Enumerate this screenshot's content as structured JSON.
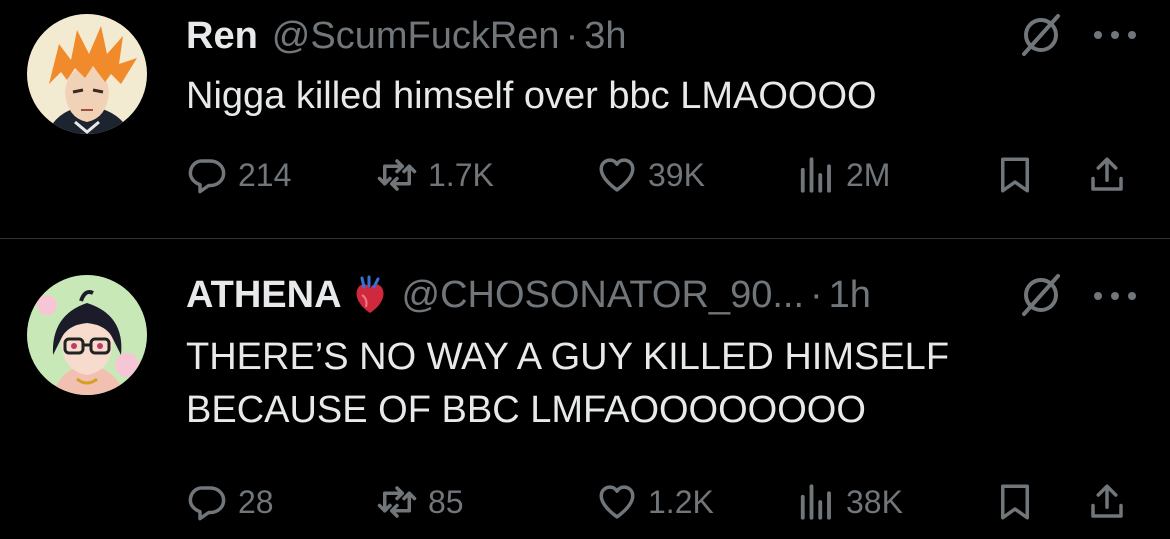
{
  "tweets": [
    {
      "name": "Ren",
      "handle": "@ScumFuckRen",
      "separator": "·",
      "time": "3h",
      "text": "Nigga killed himself over bbc LMAOOOO",
      "replies": "214",
      "retweets": "1.7K",
      "likes": "39K",
      "views": "2M",
      "avatar_icon": "anime-orange-hair-avatar",
      "name_emoji": ""
    },
    {
      "name": "ATHENA",
      "handle": "@CHOSONATOR_90...",
      "separator": "·",
      "time": "1h",
      "text_lines": [
        "THERE’S NO WAY A GUY KILLED HIMSELF",
        "BECAUSE OF BBC LMFAOOOOOOOO"
      ],
      "replies": "28",
      "retweets": "85",
      "likes": "1.2K",
      "views": "38K",
      "avatar_icon": "anime-glasses-girl-avatar",
      "name_emoji": "anatomical-heart-emoji"
    }
  ],
  "colors": {
    "background": "#000000",
    "primary_text": "#e7e9ea",
    "secondary_text": "#71767b",
    "divider": "#2f3336"
  }
}
